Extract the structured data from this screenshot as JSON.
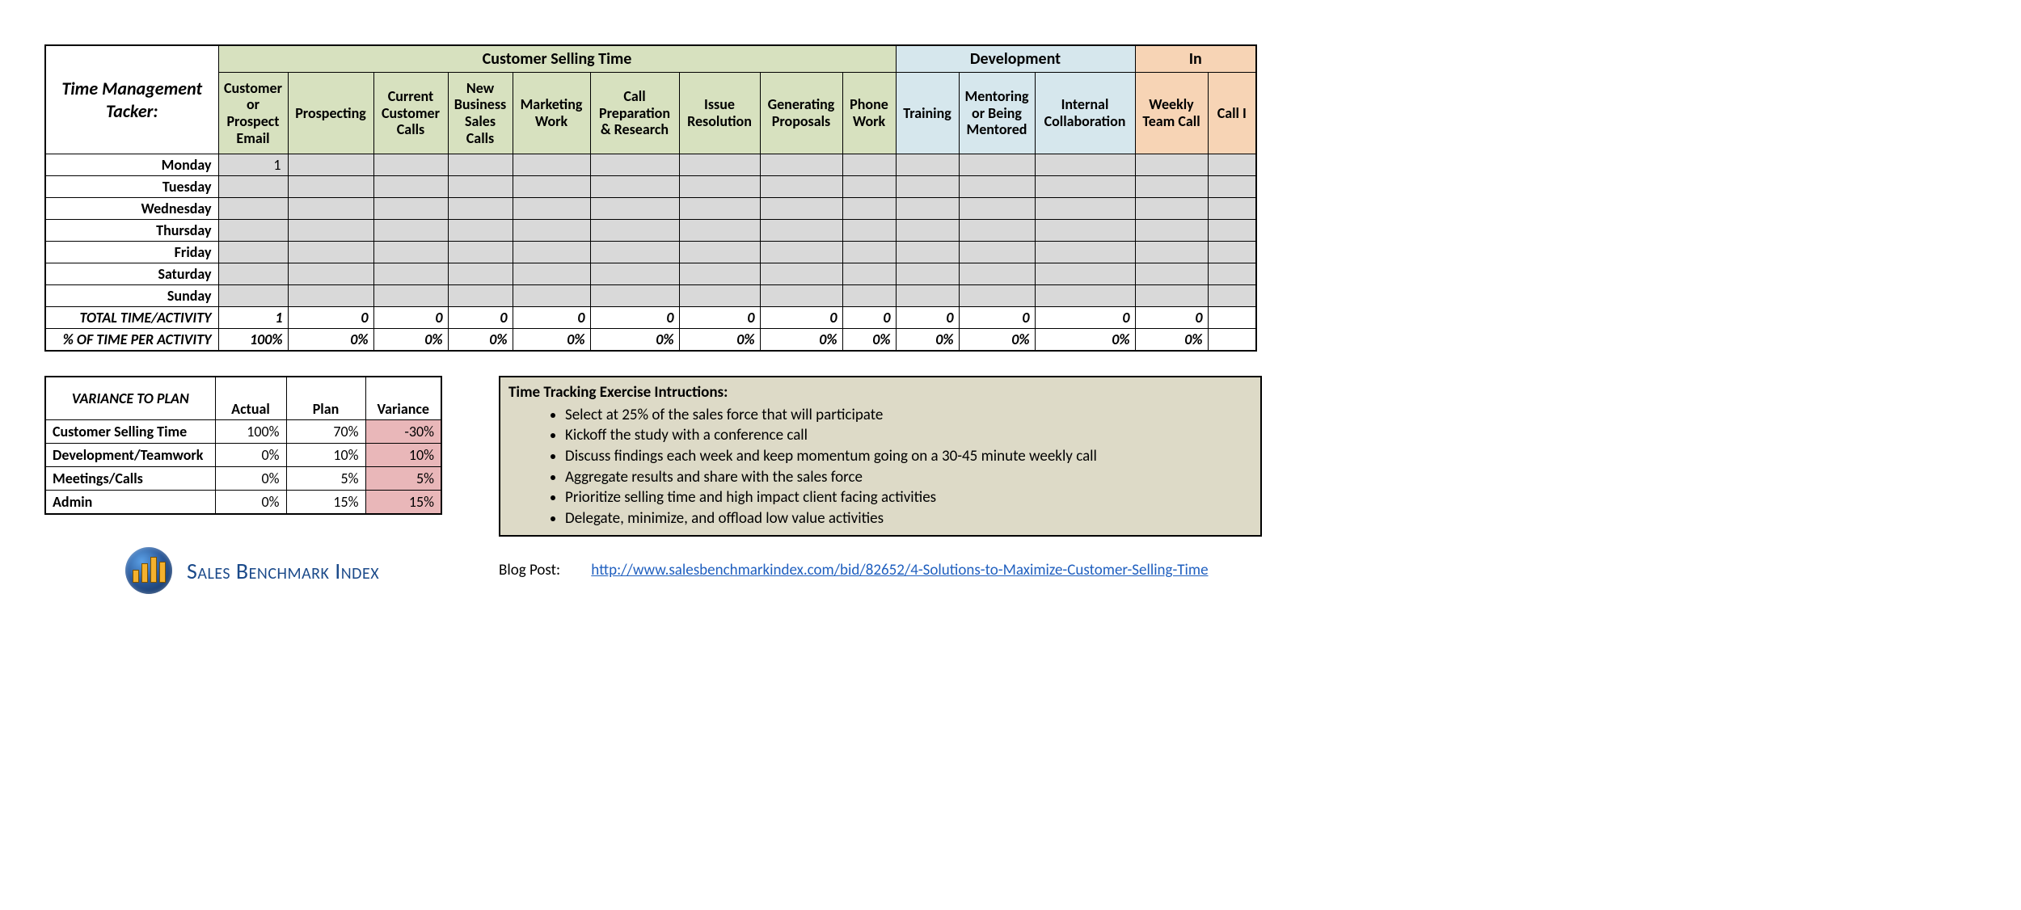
{
  "tracker": {
    "title": "Time Management Tacker:",
    "groups": [
      {
        "label": "Customer Selling Time",
        "span": 9,
        "class": "bg-green"
      },
      {
        "label": "Development",
        "span": 3,
        "class": "bg-blue"
      },
      {
        "label": "In",
        "span": 2,
        "class": "bg-orange"
      }
    ],
    "columns": [
      "Customer or Prospect Email",
      "Prospecting",
      "Current Customer Calls",
      "New Business Sales Calls",
      "Marketing Work",
      "Call Preparation & Research",
      "Issue Resolution",
      "Generating Proposals",
      "Phone Work",
      "Training",
      "Mentoring or Being Mentored",
      "Internal Collaboration",
      "Weekly Team Call",
      "Call I"
    ],
    "days": [
      "Monday",
      "Tuesday",
      "Wednesday",
      "Thursday",
      "Friday",
      "Saturday",
      "Sunday"
    ],
    "day_values": {
      "Monday": [
        "1",
        "",
        "",
        "",
        "",
        "",
        "",
        "",
        "",
        "",
        "",
        "",
        "",
        ""
      ]
    },
    "total_row_label": "TOTAL TIME/ACTIVITY",
    "total_row": [
      "1",
      "0",
      "0",
      "0",
      "0",
      "0",
      "0",
      "0",
      "0",
      "0",
      "0",
      "0",
      "0",
      ""
    ],
    "pct_row_label": "% OF TIME PER ACTIVITY",
    "pct_row": [
      "100%",
      "0%",
      "0%",
      "0%",
      "0%",
      "0%",
      "0%",
      "0%",
      "0%",
      "0%",
      "0%",
      "0%",
      "0%",
      ""
    ]
  },
  "variance": {
    "title": "VARIANCE TO PLAN",
    "headers": [
      "Actual",
      "Plan",
      "Variance"
    ],
    "rows": [
      {
        "label": "Customer Selling Time",
        "actual": "100%",
        "plan": "70%",
        "variance": "-30%"
      },
      {
        "label": "Development/Teamwork",
        "actual": "0%",
        "plan": "10%",
        "variance": "10%"
      },
      {
        "label": "Meetings/Calls",
        "actual": "0%",
        "plan": "5%",
        "variance": "5%"
      },
      {
        "label": "Admin",
        "actual": "0%",
        "plan": "15%",
        "variance": "15%"
      }
    ]
  },
  "instructions": {
    "title": "Time Tracking Exercise Intructions:",
    "items": [
      "Select at 25% of the sales force that will participate",
      "Kickoff the study with a conference call",
      "Discuss findings each week and keep momentum going on a 30-45 minute weekly call",
      "Aggregate results and share with the sales force",
      "Prioritize selling time and high impact client facing activities",
      "Delegate, minimize, and offload low value activities"
    ]
  },
  "blog": {
    "label": "Blog Post:",
    "url": "http://www.salesbenchmarkindex.com/bid/82652/4-Solutions-to-Maximize-Customer-Selling-Time"
  },
  "brand": {
    "name": "Sales Benchmark Index"
  }
}
